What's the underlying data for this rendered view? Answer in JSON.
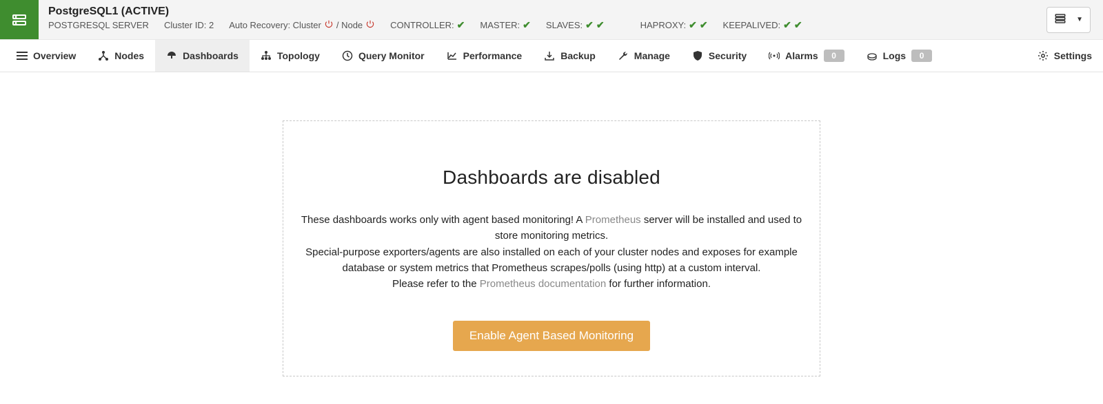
{
  "header": {
    "title": "PostgreSQL1 (ACTIVE)",
    "server_type": "POSTGRESQL SERVER",
    "cluster_id_label": "Cluster ID: 2",
    "auto_recovery_prefix": "Auto Recovery: Cluster",
    "auto_recovery_sep": "/ Node",
    "status": {
      "controller_label": "CONTROLLER:",
      "master_label": "MASTER:",
      "slaves_label": "SLAVES:",
      "haproxy_label": "HAPROXY:",
      "keepalived_label": "KEEPALIVED:"
    }
  },
  "tabs": {
    "overview": "Overview",
    "nodes": "Nodes",
    "dashboards": "Dashboards",
    "topology": "Topology",
    "query_monitor": "Query Monitor",
    "performance": "Performance",
    "backup": "Backup",
    "manage": "Manage",
    "security": "Security",
    "alarms": "Alarms",
    "alarms_count": "0",
    "logs": "Logs",
    "logs_count": "0",
    "settings": "Settings"
  },
  "panel": {
    "heading": "Dashboards are disabled",
    "line1_a": "These dashboards works only with agent based monitoring! A ",
    "line1_link": "Prometheus",
    "line1_b": " server will be installed and used to store monitoring metrics.",
    "line2": "Special-purpose exporters/agents are also installed on each of your cluster nodes and exposes for example database or system metrics that Prometheus scrapes/polls (using http) at a custom interval.",
    "line3_a": "Please refer to the ",
    "line3_link": "Prometheus documentation",
    "line3_b": " for further information.",
    "cta": "Enable Agent Based Monitoring"
  }
}
